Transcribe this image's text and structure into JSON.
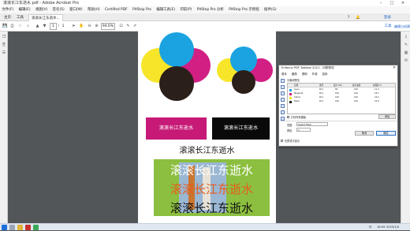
{
  "window": {
    "title": "滚滚长江东逝水.pdf - Adobe Acrobat Pro",
    "app_icon": "acrobat-icon"
  },
  "menu": [
    "文件(F)",
    "编辑(E)",
    "视图(V)",
    "签名(S)",
    "窗口(W)",
    "帮助(H)",
    "Certified PDF",
    "PitStop Pro",
    "编辑工具(E)",
    "印前(P)",
    "PitStop Pro 分析",
    "PitStop Pro 示例程",
    "插件(G)"
  ],
  "tabs": {
    "home": "主页",
    "tools": "工具",
    "document": "滚滚长江东逝水..."
  },
  "header_right": {
    "login": "登录",
    "tools": "工具",
    "edit_pdf": "编辑与创建"
  },
  "toolbar": {
    "page_current": "1",
    "page_total": "1",
    "zoom": "94.6%"
  },
  "page": {
    "boxes": [
      {
        "text": "滚滚长江东逝水",
        "color": "#c61a76"
      },
      {
        "text": "滚滚长江东逝水",
        "color": "#0a0a0a"
      }
    ],
    "heading": "滚滚长江东逝水",
    "photo_lines": [
      "滚滚长江东逝水",
      "滚滚长江东逝水",
      "滚滚长江东逝水"
    ],
    "colors": {
      "cyan": "#1aa3e0",
      "magenta": "#d11f83",
      "yellow": "#f7e52a",
      "black": "#2b1f1a",
      "green": "#8cbf3f"
    }
  },
  "dialog": {
    "title": "Enfocus PDF Toolbox 2021 - 印刷预览",
    "tabs": [
      "基本",
      "图像",
      "透明",
      "外观",
      "选择"
    ],
    "section": "分离和预览",
    "columns": [
      "名称",
      "类型",
      "最大 TAC",
      "最大油墨",
      "总面积 %"
    ],
    "rows": [
      {
        "name": "Cyan",
        "type": "Proc",
        "tac": "85",
        "ink": "100",
        "area": "12.4",
        "swatch": "#1aa3e0"
      },
      {
        "name": "Magenta",
        "type": "Proc",
        "tac": "100",
        "ink": "100",
        "area": "18.7",
        "swatch": "#d11f83"
      },
      {
        "name": "Yellow",
        "type": "Proc",
        "tac": "100",
        "ink": "100",
        "area": "16.2",
        "swatch": "#f7e52a"
      },
      {
        "name": "Black",
        "type": "Proc",
        "tac": "100",
        "ink": "100",
        "area": "21.9",
        "swatch": "#222222"
      }
    ],
    "check_label": "打印所有图版",
    "range_label": "范围",
    "range_value": "Select filter",
    "preset_label": "预设",
    "preset_value": "1",
    "btn_add": "添加",
    "btn_cancel": "取消",
    "btn_ok": "确定",
    "footer_check": "在预览中显示"
  },
  "taskbar": {
    "time": "16:09",
    "date": "2023/1/5",
    "lang": "中"
  }
}
